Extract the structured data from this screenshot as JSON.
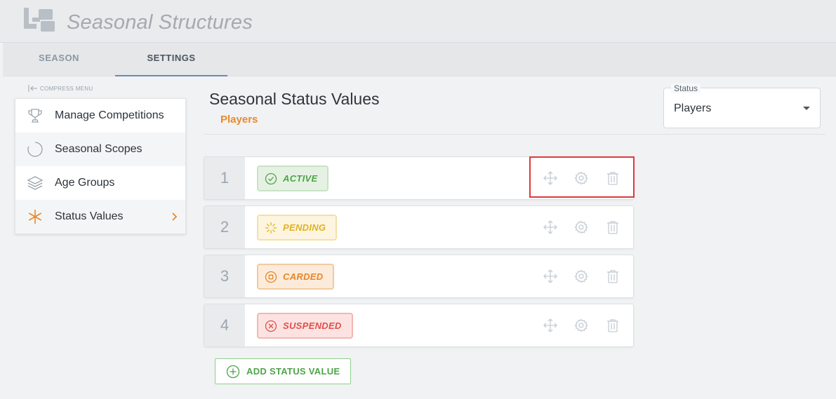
{
  "app": {
    "title": "Seasonal Structures"
  },
  "tabs": [
    {
      "label": "SEASON",
      "active": false
    },
    {
      "label": "SETTINGS",
      "active": true
    }
  ],
  "sidebar": {
    "compress_label": "COMPRESS MENU",
    "items": [
      {
        "label": "Manage Competitions",
        "icon": "trophy-icon"
      },
      {
        "label": "Seasonal Scopes",
        "icon": "circle-icon"
      },
      {
        "label": "Age Groups",
        "icon": "layers-icon"
      },
      {
        "label": "Status Values",
        "icon": "asterisk-icon",
        "selected": true
      }
    ]
  },
  "main": {
    "title": "Seasonal Status Values",
    "subtitle": "Players",
    "status_select": {
      "legend": "Status",
      "value": "Players"
    },
    "rows": [
      {
        "number": "1",
        "label": "ACTIVE",
        "icon": "check-circle-icon",
        "color": "#4fa44a"
      },
      {
        "number": "2",
        "label": "PENDING",
        "icon": "spinner-icon",
        "color": "#e2b11d"
      },
      {
        "number": "3",
        "label": "CARDED",
        "icon": "stop-circle-icon",
        "color": "#e6862a"
      },
      {
        "number": "4",
        "label": "SUSPENDED",
        "icon": "x-circle-icon",
        "color": "#e0504b"
      }
    ],
    "add_button": "ADD STATUS VALUE"
  },
  "colors": {
    "accent_orange": "#e8892c",
    "highlight_red": "#e0393e",
    "icon_gray": "#c5ccd3"
  }
}
